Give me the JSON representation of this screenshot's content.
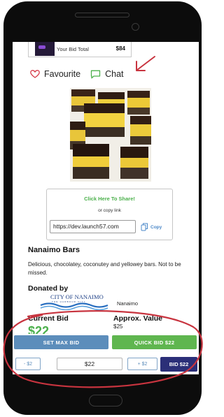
{
  "top_bar": {
    "label": "Your Bid Total",
    "value": "$84"
  },
  "actions": {
    "favourite": "Favourite",
    "chat": "Chat"
  },
  "share": {
    "link_text": "Click Here To Share!",
    "or_text": "or copy link",
    "url": "https://dev.launch57.com",
    "copy_label": "Copy"
  },
  "item": {
    "title": "Nanaimo Bars",
    "description": "Delicious, chocolatey, coconutey and yellowey bars. Not to be missed.",
    "donated_heading": "Donated by",
    "donor_logo_text": "CITY OF NANAIMO",
    "donor_logo_sub": "THE HARBOUR CITY",
    "donor_name": "Nanaimo"
  },
  "bid": {
    "current_label": "Current Bid",
    "current_value": "$22",
    "approx_label": "Approx. Value",
    "approx_value": "$25",
    "set_max": "SET MAX BID",
    "quick_bid": "QUICK BID $22",
    "minus": "- $2",
    "amount": "$22",
    "plus": "+ $2",
    "bid_button": "BID $22"
  },
  "colors": {
    "accent_green": "#5fb64f",
    "accent_blue": "#5c8dbb",
    "bid_navy": "#2b2f78",
    "annotation_red": "#c8343f"
  },
  "icons": [
    "heart-icon",
    "chat-bubble-icon",
    "copy-icon",
    "annotation-arrow-icon"
  ]
}
